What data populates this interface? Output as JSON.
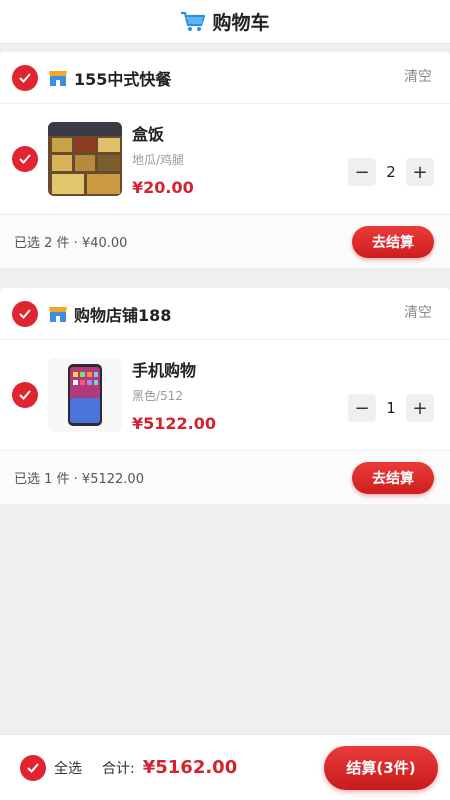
{
  "header": {
    "title": "购物车",
    "icon": "cart-icon"
  },
  "shops": [
    {
      "name": "155中式快餐",
      "clear_label": "清空",
      "items": [
        {
          "name": "盒饭",
          "spec": "地瓜/鸡腿",
          "price": "¥20.00",
          "qty": "2",
          "image": "food-tray-photo"
        }
      ],
      "summary": "已选 2 件 · ¥40.00",
      "pay_label": "去结算"
    },
    {
      "name": "购物店铺188",
      "clear_label": "清空",
      "items": [
        {
          "name": "手机购物",
          "spec": "黑色/512",
          "price": "¥5122.00",
          "qty": "1",
          "image": "phone-photo"
        }
      ],
      "summary": "已选 1 件 · ¥5122.00",
      "pay_label": "去结算"
    }
  ],
  "bottom": {
    "select_all_label": "全选",
    "total_label": "合计:",
    "total_value": "¥5162.00",
    "checkout_label": "结算(3件)"
  },
  "colors": {
    "accent": "#e02430",
    "price": "#d4232f",
    "background": "#efefef"
  },
  "stepper": {
    "minus": "−",
    "plus": "+"
  }
}
